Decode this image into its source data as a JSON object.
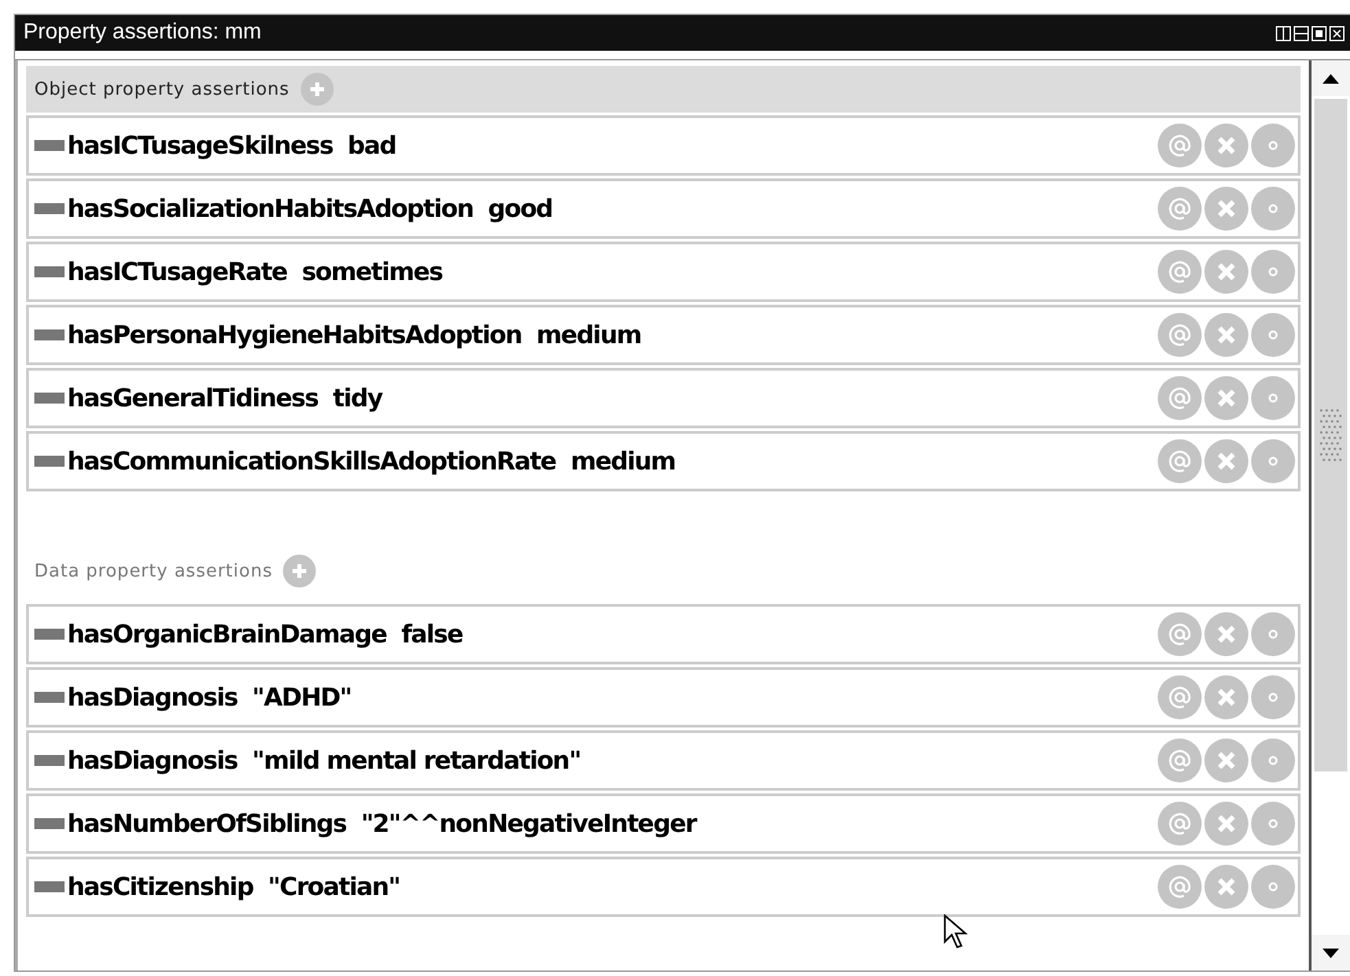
{
  "window": {
    "title": "Property assertions: mm"
  },
  "sections": [
    {
      "title": "Object property assertions",
      "kind": "object",
      "rows": [
        {
          "property": "hasICTusageSkilness",
          "value": "bad"
        },
        {
          "property": "hasSocializationHabitsAdoption",
          "value": "good"
        },
        {
          "property": "hasICTusageRate",
          "value": "sometimes"
        },
        {
          "property": "hasPersonaHygieneHabitsAdoption",
          "value": "medium"
        },
        {
          "property": "hasGeneralTidiness",
          "value": "tidy"
        },
        {
          "property": "hasCommunicationSkillsAdoptionRate",
          "value": "medium"
        }
      ]
    },
    {
      "title": "Data property assertions",
      "kind": "data",
      "rows": [
        {
          "property": "hasOrganicBrainDamage",
          "value": "false"
        },
        {
          "property": "hasDiagnosis",
          "value": "\"ADHD\""
        },
        {
          "property": "hasDiagnosis",
          "value": "\"mild mental retardation\""
        },
        {
          "property": "hasNumberOfSiblings",
          "value": "\"2\"^^nonNegativeInteger"
        },
        {
          "property": "hasCitizenship",
          "value": "\"Croatian\""
        }
      ]
    }
  ]
}
